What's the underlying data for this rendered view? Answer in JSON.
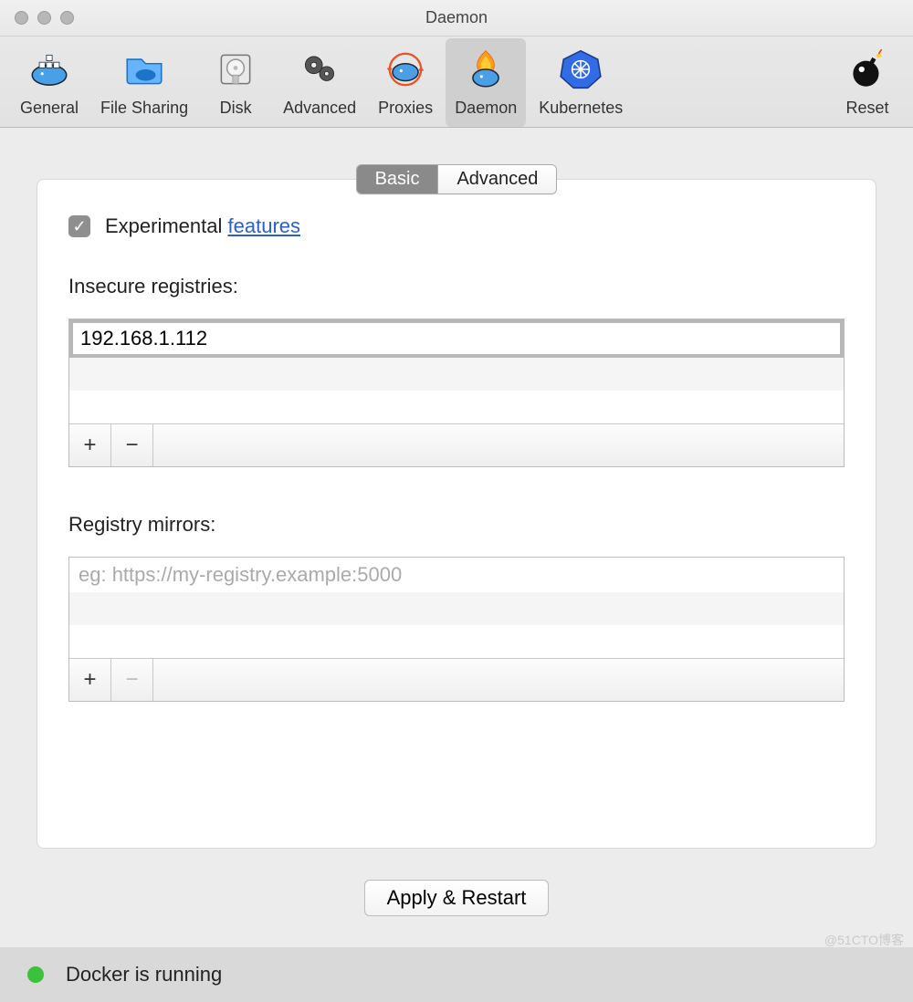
{
  "window": {
    "title": "Daemon"
  },
  "toolbar": {
    "items": [
      {
        "label": "General"
      },
      {
        "label": "File Sharing"
      },
      {
        "label": "Disk"
      },
      {
        "label": "Advanced"
      },
      {
        "label": "Proxies"
      },
      {
        "label": "Daemon"
      },
      {
        "label": "Kubernetes"
      }
    ],
    "reset_label": "Reset",
    "active_index": 5
  },
  "segmented": {
    "basic": "Basic",
    "advanced": "Advanced",
    "active": "basic"
  },
  "experimental": {
    "prefix": "Experimental ",
    "link": "features",
    "checked": true
  },
  "insecure": {
    "label": "Insecure registries:",
    "value": "192.168.1.112"
  },
  "mirrors": {
    "label": "Registry mirrors:",
    "placeholder": "eg: https://my-registry.example:5000",
    "value": ""
  },
  "apply": {
    "label": "Apply & Restart"
  },
  "status": {
    "text": "Docker is running",
    "color": "#3ac33a"
  },
  "watermark": "@51CTO博客"
}
